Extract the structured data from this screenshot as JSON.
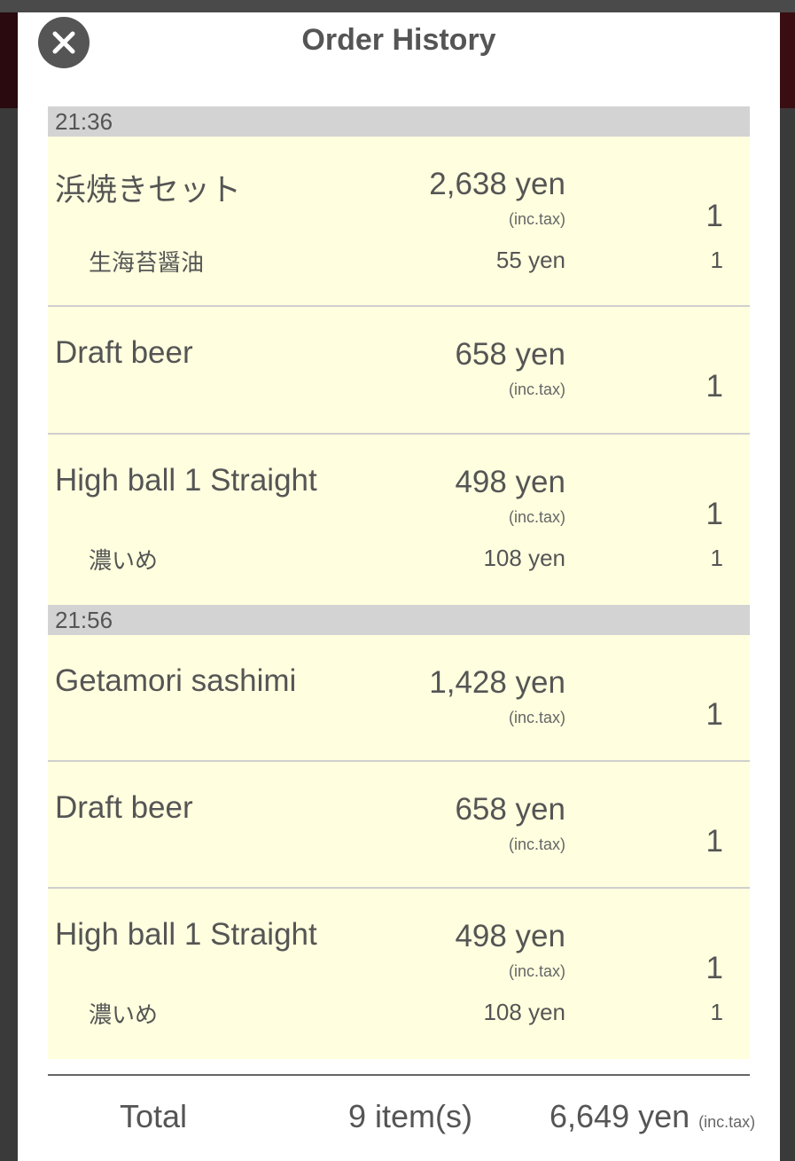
{
  "header": {
    "title": "Order History",
    "close_icon": "close-icon"
  },
  "groups": [
    {
      "time": "21:36",
      "items": [
        {
          "name": "浜焼きセット",
          "price": "2,638 yen",
          "tax": "(inc.tax)",
          "qty": "1",
          "option": {
            "name": "生海苔醤油",
            "price": "55 yen",
            "qty": "1"
          }
        },
        {
          "name": "Draft beer",
          "price": "658 yen",
          "tax": "(inc.tax)",
          "qty": "1"
        },
        {
          "name": "High ball 1 Straight",
          "price": "498 yen",
          "tax": "(inc.tax)",
          "qty": "1",
          "option": {
            "name": "濃いめ",
            "price": "108 yen",
            "qty": "1"
          }
        }
      ]
    },
    {
      "time": "21:56",
      "items": [
        {
          "name": "Getamori sashimi",
          "price": "1,428 yen",
          "tax": "(inc.tax)",
          "qty": "1"
        },
        {
          "name": "Draft beer",
          "price": "658 yen",
          "tax": "(inc.tax)",
          "qty": "1"
        },
        {
          "name": "High ball 1 Straight",
          "price": "498 yen",
          "tax": "(inc.tax)",
          "qty": "1",
          "option": {
            "name": "濃いめ",
            "price": "108 yen",
            "qty": "1"
          }
        }
      ]
    }
  ],
  "footer": {
    "total_label": "Total",
    "total_items": "9 item(s)",
    "total_amount": "6,649 yen",
    "total_tax": "(inc.tax)"
  }
}
